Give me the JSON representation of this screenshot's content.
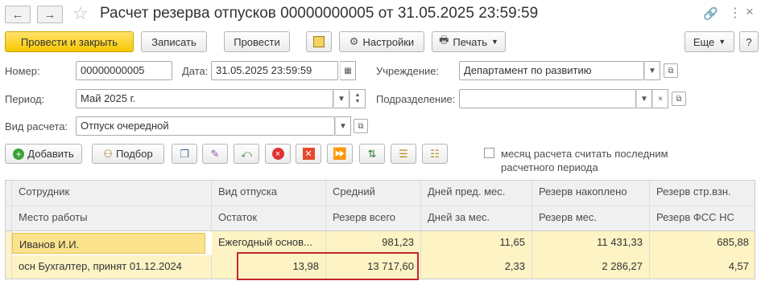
{
  "title": "Расчет резерва отпусков 00000000005 от 31.05.2025 23:59:59",
  "toolbar": {
    "post_close": "Провести и закрыть",
    "save": "Записать",
    "post": "Провести",
    "settings": "Настройки",
    "print": "Печать",
    "more": "Еще",
    "help": "?"
  },
  "form": {
    "number_label": "Номер:",
    "number_value": "00000000005",
    "date_label": "Дата:",
    "date_value": "31.05.2025 23:59:59",
    "institution_label": "Учреждение:",
    "institution_value": "Департамент по развитию",
    "period_label": "Период:",
    "period_value": "Май 2025 г.",
    "division_label": "Подразделение:",
    "division_value": "",
    "calc_type_label": "Вид расчета:",
    "calc_type_value": "Отпуск очередной"
  },
  "table_toolbar": {
    "add": "Добавить",
    "pick": "Подбор",
    "checkbox_text_1": "месяц расчета считать последним",
    "checkbox_text_2": "расчетного периода"
  },
  "table": {
    "headers_top": [
      "Сотрудник",
      "Вид отпуска",
      "Средний",
      "Дней пред. мес.",
      "Резерв накоплено",
      "Резерв стр.взн."
    ],
    "headers_bottom": [
      "Место работы",
      "Остаток",
      "Резерв всего",
      "Дней за мес.",
      "Резерв мес.",
      "Резерв ФСС НС"
    ],
    "row_top": [
      "Иванов И.И.",
      "Ежегодный основ...",
      "981,23",
      "11,65",
      "11 431,33",
      "685,88"
    ],
    "row_bottom": [
      "осн Бухгалтер, принят 01.12.2024",
      "13,98",
      "13 717,60",
      "2,33",
      "2 286,27",
      "4,57"
    ]
  },
  "colors": {
    "primary_button": "#f5c800",
    "selected_row": "#fdf3c4",
    "highlight_box": "#c0272d"
  }
}
